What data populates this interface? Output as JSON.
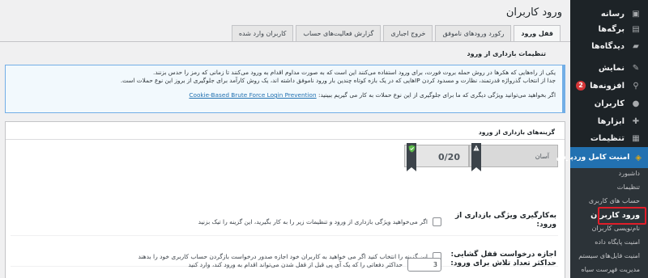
{
  "sidebar": {
    "items": [
      {
        "label": "رسانه",
        "icon": "media-icon",
        "glyph": "▣"
      },
      {
        "label": "برگه‌ها",
        "icon": "pages-icon",
        "glyph": "▤"
      },
      {
        "label": "دیدگاه‌ها",
        "icon": "comments-icon",
        "glyph": "▰"
      },
      {
        "label": "نمایش",
        "icon": "appearance-icon",
        "glyph": "✎"
      },
      {
        "label": "افزونه‌ها",
        "icon": "plugins-icon",
        "glyph": "⚲",
        "badge": "2"
      },
      {
        "label": "کاربران",
        "icon": "users-icon",
        "glyph": "●"
      },
      {
        "label": "ابزارها",
        "icon": "tools-icon",
        "glyph": "✚"
      },
      {
        "label": "تنظیمات",
        "icon": "settings-icon",
        "glyph": "▦"
      }
    ],
    "active_item": {
      "label": "امنیت کامل وردپرس",
      "icon": "shield-icon",
      "glyph": "◈"
    },
    "submenu": [
      "داشبورد",
      "تنظیمات",
      "حساب های کاربری",
      "ورود کاربران",
      "نام‌نویسی کاربران",
      "امنیت پایگاه داده",
      "امنیت فایل‌های سیستم",
      "مدیریت فهرست سیاه"
    ],
    "current_submenu_index": 3
  },
  "page": {
    "title": "ورود کاربران",
    "tabs": [
      "قفل ورود",
      "رکورد ورودهای ناموفق",
      "خروج اجباری",
      "گزارش فعالیت‌های حساب",
      "کاربران وارد شده"
    ],
    "active_tab_index": 0,
    "section_title": "تنظیمات بازداری از ورود",
    "notice": {
      "line1": "یکی از راه‌هایی که هکرها در روش حمله بروت فورت، برای ورود استفاده می‌کنند این است که به صورت مداوم اقدام به ورود می‌کنند تا زمانی که رمز را حدس بزنند.",
      "line2": "جدا از انتخاب گذرواژه قدرتمند، نظارت و مسدود کردن IPهایی که در یک بازه کوتاه چندین بار ورود ناموفق داشته اند، یک روش کارآمد برای جلوگیری از بروز این نوع حملات است.",
      "line3": "اگر بخواهید می‌توانید ویژگی دیگری که ما برای جلوگیری از این نوع حملات به کار می گیریم ببینید:",
      "link": "Cookie-Based Brute Force Login Prevention"
    },
    "panel": {
      "title": "گزینه‌های بازداری از ورود",
      "score": "0/20",
      "level": "آسان",
      "rows": [
        {
          "label": "به‌کارگیری ویژگی بازداری از ورود:",
          "text": "اگر می‌خواهید ویژگی بازداری از ورود و تنظیمات زیر را به کار بگیرید، این گزینه را تیک بزنید"
        },
        {
          "label": "اجازه درخواست قفل گشایی:",
          "text": "این گزینه را انتخاب کنید اگر می خواهید به کاربران خود اجازه صدور درخواست بازگردن حساب کاربری خود را بدهند"
        },
        {
          "label": "حداکثر تعداد تلاش برای ورود:",
          "value": "3",
          "text": "حداکثر دفعاتی را که یک آی پی قبل از قفل شدن می‌تواند اقدام به ورود کند، وارد کنید"
        }
      ]
    }
  },
  "colors": {
    "sidebar_bg": "#1d2327",
    "active_menu": "#2271b1",
    "badge": "#d63638",
    "highlight": "#e01e2a",
    "notice_border": "#72aee6"
  }
}
